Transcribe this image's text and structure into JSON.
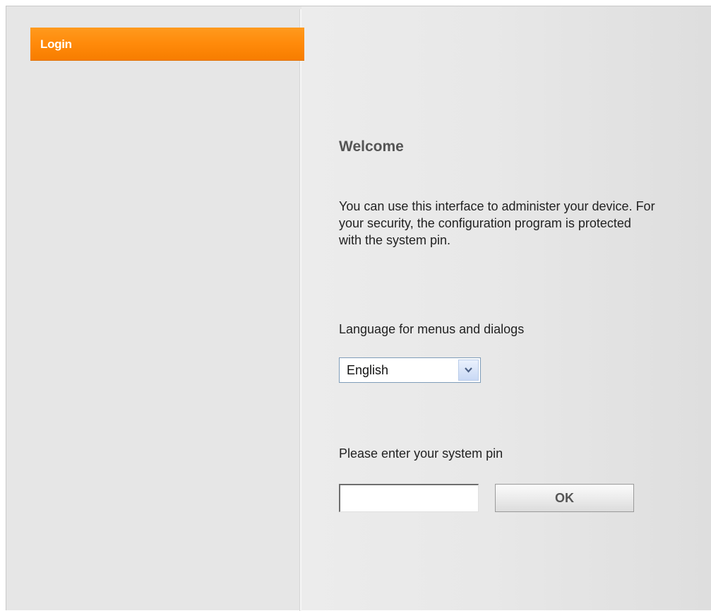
{
  "sidebar": {
    "items": [
      {
        "label": "Login",
        "active": true
      }
    ],
    "accent_color": "#ff8a0a"
  },
  "main": {
    "heading": "Welcome",
    "intro_text": "You can use this interface to administer your device. For your security, the configuration program is protected with the system pin.",
    "language": {
      "label": "Language for menus and dialogs",
      "selected": "English",
      "icon": "chevron-down-icon"
    },
    "pin": {
      "label": "Please enter your system pin",
      "value": "",
      "placeholder": ""
    },
    "ok_button_label": "OK"
  }
}
